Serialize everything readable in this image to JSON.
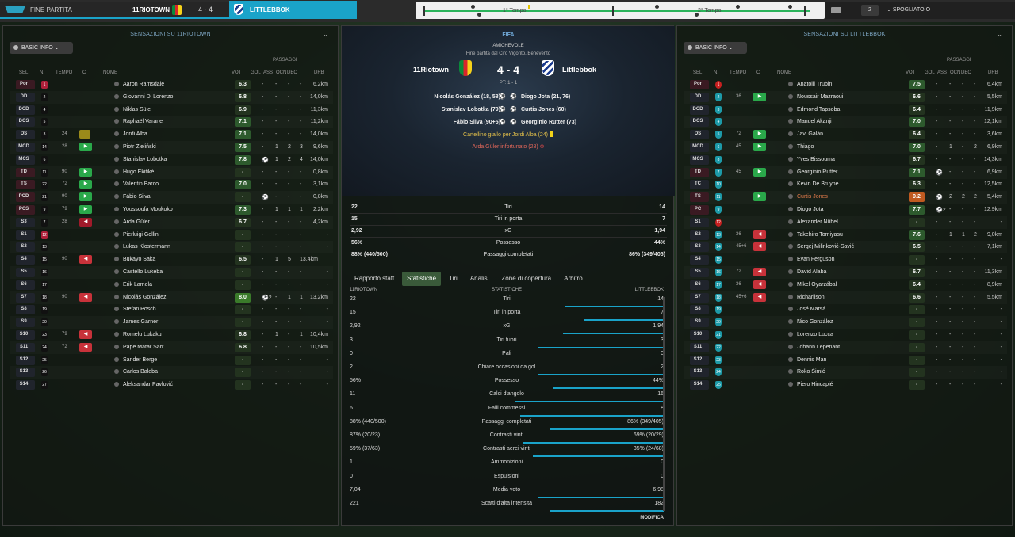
{
  "topbar": {
    "status": "FINE PARTITA",
    "home": "11RIOTOWN",
    "score": "4 - 4",
    "away": "LITTLEBBOK",
    "first_half": "1° Tempo",
    "second_half": "2° Tempo",
    "subs": "2",
    "dropdown": "SPOGLIATOIO"
  },
  "left": {
    "title": "SENSAZIONI SU 11RIOTOWN",
    "basic": "BASIC INFO",
    "passaggi": "PASSAGGI",
    "headers": {
      "sel": "SEL",
      "n": "N.",
      "tempo": "TEMPO",
      "c": "C",
      "nome": "NOME",
      "vot": "VOT",
      "gol": "GOL",
      "ass": "ASS",
      "ocn": "OCN",
      "dec": "DEC",
      "drb": "DRB"
    },
    "rows": [
      {
        "pos": "Por",
        "num": "1",
        "tempo": "",
        "name": "Aaron Ramsdale",
        "vot": "6.3",
        "gol": "-",
        "ass": "-",
        "ocn": "-",
        "dec": "-",
        "drb": "6,2km",
        "pc": "#3a1a22",
        "vc": "#23331f",
        "gk": true
      },
      {
        "pos": "DD",
        "num": "2",
        "tempo": "",
        "name": "Giovanni Di Lorenzo",
        "vot": "6.8",
        "gol": "-",
        "ass": "-",
        "ocn": "-",
        "dec": "-",
        "drb": "14,0km",
        "pc": "#20242c",
        "vc": "#23331f"
      },
      {
        "pos": "DCD",
        "num": "4",
        "tempo": "",
        "name": "Niklas Süle",
        "vot": "6.9",
        "gol": "-",
        "ass": "-",
        "ocn": "-",
        "dec": "-",
        "drb": "11,3km",
        "pc": "#20242c",
        "vc": "#23331f"
      },
      {
        "pos": "DCS",
        "num": "5",
        "tempo": "",
        "name": "Raphaël Varane",
        "vot": "7.1",
        "gol": "-",
        "ass": "-",
        "ocn": "-",
        "dec": "-",
        "drb": "11,2km",
        "pc": "#20242c",
        "vc": "#2d5a2d"
      },
      {
        "pos": "DS",
        "num": "3",
        "tempo": "24",
        "name": "Jordi Alba",
        "vot": "7.1",
        "gol": "-",
        "ass": "-",
        "ocn": "-",
        "dec": "-",
        "drb": "14,0km",
        "pc": "#20242c",
        "vc": "#2d5a2d",
        "yc": true
      },
      {
        "pos": "MCD",
        "num": "14",
        "tempo": "28",
        "name": "Piotr Zieliński",
        "vot": "7.5",
        "gol": "-",
        "ass": "1",
        "ocn": "2",
        "dec": "3",
        "drb": "9,6km",
        "pc": "#20242c",
        "vc": "#2d5a2d",
        "chip": "#2aa84a"
      },
      {
        "pos": "MCS",
        "num": "6",
        "tempo": "",
        "name": "Stanislav Lobotka",
        "vot": "7.8",
        "gol": "⚽",
        "ass": "1",
        "ocn": "2",
        "dec": "4",
        "drb": "14,0km",
        "pc": "#20242c",
        "vc": "#2d5a2d"
      },
      {
        "pos": "TD",
        "num": "11",
        "tempo": "90",
        "name": "Hugo Ekitiké",
        "vot": "-",
        "gol": "-",
        "ass": "-",
        "ocn": "-",
        "dec": "-",
        "drb": "0,8km",
        "pc": "#3a1a22",
        "vc": "#23331f",
        "chip": "#2aa84a"
      },
      {
        "pos": "TS",
        "num": "22",
        "tempo": "72",
        "name": "Valentin Barco",
        "vot": "7.0",
        "gol": "-",
        "ass": "-",
        "ocn": "-",
        "dec": "-",
        "drb": "3,1km",
        "pc": "#3a1a22",
        "vc": "#2d5a2d",
        "chip": "#2aa84a"
      },
      {
        "pos": "PCD",
        "num": "21",
        "tempo": "90",
        "name": "Fábio Silva",
        "vot": "-",
        "gol": "⚽",
        "ass": "-",
        "ocn": "-",
        "dec": "-",
        "drb": "0,8km",
        "pc": "#3a1a22",
        "vc": "#23331f",
        "chip": "#2aa84a"
      },
      {
        "pos": "PCS",
        "num": "9",
        "tempo": "79",
        "name": "Youssoufa Moukoko",
        "vot": "7.3",
        "gol": "-",
        "ass": "1",
        "ocn": "1",
        "dec": "1",
        "drb": "2,2km",
        "pc": "#3a1a22",
        "vc": "#2d5a2d",
        "chip": "#2aa84a"
      },
      {
        "pos": "S3",
        "num": "7",
        "tempo": "28",
        "name": "Arda Güler",
        "vot": "6.7",
        "gol": "-",
        "ass": "-",
        "ocn": "-",
        "dec": "-",
        "drb": "4,2km",
        "pc": "#20242c",
        "vc": "#23331f",
        "chip": "#a01a2a"
      },
      {
        "pos": "S1",
        "num": "12",
        "tempo": "",
        "name": "Pierluigi Gollini",
        "vot": "-",
        "gol": "-",
        "ass": "-",
        "ocn": "-",
        "dec": "-",
        "drb": "-",
        "pc": "#20242c",
        "vc": "#23331f",
        "gk": true
      },
      {
        "pos": "S2",
        "num": "13",
        "tempo": "",
        "name": "Lukas Klostermann",
        "vot": "-",
        "gol": "-",
        "ass": "-",
        "ocn": "-",
        "dec": "-",
        "drb": "-",
        "pc": "#20242c",
        "vc": "#23331f"
      },
      {
        "pos": "S4",
        "num": "15",
        "tempo": "90",
        "name": "Bukayo Saka",
        "vot": "6.5",
        "gol": "-",
        "ass": "1",
        "ocn": "5",
        "dec": "13,4km",
        "drb": "",
        "pc": "#20242c",
        "vc": "#23331f",
        "chip": "#c8323a"
      },
      {
        "pos": "S5",
        "num": "16",
        "tempo": "",
        "name": "Castello Lukeba",
        "vot": "-",
        "gol": "-",
        "ass": "-",
        "ocn": "-",
        "dec": "-",
        "drb": "-",
        "pc": "#20242c",
        "vc": "#23331f"
      },
      {
        "pos": "S6",
        "num": "17",
        "tempo": "",
        "name": "Erik Lamela",
        "vot": "-",
        "gol": "-",
        "ass": "-",
        "ocn": "-",
        "dec": "-",
        "drb": "-",
        "pc": "#20242c",
        "vc": "#23331f"
      },
      {
        "pos": "S7",
        "num": "18",
        "tempo": "90",
        "name": "Nicolás González",
        "vot": "8.0",
        "gol": "⚽2",
        "ass": "-",
        "ocn": "1",
        "dec": "1",
        "drb": "13,2km",
        "pc": "#20242c",
        "vc": "#3a7a2a",
        "chip": "#c8323a"
      },
      {
        "pos": "S8",
        "num": "19",
        "tempo": "",
        "name": "Stefan Posch",
        "vot": "-",
        "gol": "-",
        "ass": "-",
        "ocn": "-",
        "dec": "-",
        "drb": "-",
        "pc": "#20242c",
        "vc": "#23331f"
      },
      {
        "pos": "S9",
        "num": "20",
        "tempo": "",
        "name": "James Garner",
        "vot": "-",
        "gol": "-",
        "ass": "-",
        "ocn": "-",
        "dec": "-",
        "drb": "-",
        "pc": "#20242c",
        "vc": "#23331f"
      },
      {
        "pos": "S10",
        "num": "23",
        "tempo": "79",
        "name": "Romelu Lukaku",
        "vot": "6.8",
        "gol": "-",
        "ass": "1",
        "ocn": "-",
        "dec": "1",
        "drb": "10,4km",
        "pc": "#20242c",
        "vc": "#23331f",
        "chip": "#c8323a"
      },
      {
        "pos": "S11",
        "num": "24",
        "tempo": "72",
        "name": "Pape Matar Sarr",
        "vot": "6.8",
        "gol": "-",
        "ass": "-",
        "ocn": "-",
        "dec": "-",
        "drb": "10,5km",
        "pc": "#20242c",
        "vc": "#23331f",
        "chip": "#c8323a"
      },
      {
        "pos": "S12",
        "num": "25",
        "tempo": "",
        "name": "Sander Berge",
        "vot": "-",
        "gol": "-",
        "ass": "-",
        "ocn": "-",
        "dec": "-",
        "drb": "-",
        "pc": "#20242c",
        "vc": "#23331f"
      },
      {
        "pos": "S13",
        "num": "26",
        "tempo": "",
        "name": "Carlos Baleba",
        "vot": "-",
        "gol": "-",
        "ass": "-",
        "ocn": "-",
        "dec": "-",
        "drb": "-",
        "pc": "#20242c",
        "vc": "#23331f"
      },
      {
        "pos": "S14",
        "num": "27",
        "tempo": "",
        "name": "Aleksandar Pavlović",
        "vot": "-",
        "gol": "-",
        "ass": "-",
        "ocn": "-",
        "dec": "-",
        "drb": "-",
        "pc": "#20242c",
        "vc": "#23331f"
      }
    ]
  },
  "right": {
    "title": "SENSAZIONI SU LITTLEBBOK",
    "basic": "BASIC INFO",
    "passaggi": "PASSAGGI",
    "rows": [
      {
        "pos": "Por",
        "num": "1",
        "tempo": "",
        "name": "Anatolii Trubin",
        "vot": "7.5",
        "gol": "-",
        "ass": "-",
        "ocn": "-",
        "dec": "-",
        "drb": "6,4km",
        "pc": "#3a1a22",
        "vc": "#2d5a2d",
        "gk": true
      },
      {
        "pos": "DD",
        "num": "2",
        "tempo": "36",
        "name": "Noussair Mazraoui",
        "vot": "6.6",
        "gol": "-",
        "ass": "-",
        "ocn": "-",
        "dec": "-",
        "drb": "5,5km",
        "pc": "#20242c",
        "vc": "#23331f",
        "chip": "#2aa84a"
      },
      {
        "pos": "DCD",
        "num": "3",
        "tempo": "",
        "name": "Edmond Tapsoba",
        "vot": "6.4",
        "gol": "-",
        "ass": "-",
        "ocn": "-",
        "dec": "-",
        "drb": "11,9km",
        "pc": "#20242c",
        "vc": "#23331f"
      },
      {
        "pos": "DCS",
        "num": "4",
        "tempo": "",
        "name": "Manuel Akanji",
        "vot": "7.0",
        "gol": "-",
        "ass": "-",
        "ocn": "-",
        "dec": "-",
        "drb": "12,1km",
        "pc": "#20242c",
        "vc": "#2d5a2d"
      },
      {
        "pos": "DS",
        "num": "5",
        "tempo": "72",
        "name": "Javi Galán",
        "vot": "6.4",
        "gol": "-",
        "ass": "-",
        "ocn": "-",
        "dec": "-",
        "drb": "3,6km",
        "pc": "#20242c",
        "vc": "#23331f",
        "chip": "#2aa84a"
      },
      {
        "pos": "MCD",
        "num": "6",
        "tempo": "45",
        "name": "Thiago",
        "vot": "7.0",
        "gol": "-",
        "ass": "1",
        "ocn": "-",
        "dec": "2",
        "drb": "6,9km",
        "pc": "#20242c",
        "vc": "#2d5a2d",
        "chip": "#2aa84a"
      },
      {
        "pos": "MCS",
        "num": "8",
        "tempo": "",
        "name": "Yves Bissouma",
        "vot": "6.7",
        "gol": "-",
        "ass": "-",
        "ocn": "-",
        "dec": "-",
        "drb": "14,3km",
        "pc": "#20242c",
        "vc": "#23331f"
      },
      {
        "pos": "TD",
        "num": "7",
        "tempo": "45",
        "name": "Georginio Rutter",
        "vot": "7.1",
        "gol": "⚽",
        "ass": "-",
        "ocn": "-",
        "dec": "-",
        "drb": "6,9km",
        "pc": "#3a1a22",
        "vc": "#2d5a2d",
        "chip": "#2aa84a"
      },
      {
        "pos": "TC",
        "num": "10",
        "tempo": "",
        "name": "Kevin De Bruyne",
        "vot": "6.3",
        "gol": "-",
        "ass": "-",
        "ocn": "-",
        "dec": "-",
        "drb": "12,5km",
        "pc": "#20242c",
        "vc": "#23331f"
      },
      {
        "pos": "TS",
        "num": "11",
        "tempo": "",
        "name": "Curtis Jones",
        "vot": "9.2",
        "gol": "⚽",
        "ass": "2",
        "ocn": "2",
        "dec": "2",
        "drb": "5,4km",
        "pc": "#3a1a22",
        "vc": "#c05a20",
        "chip": "#2aa84a",
        "hi": true
      },
      {
        "pos": "PC",
        "num": "9",
        "tempo": "",
        "name": "Diogo Jota",
        "vot": "7.7",
        "gol": "⚽2",
        "ass": "-",
        "ocn": "-",
        "dec": "-",
        "drb": "12,9km",
        "pc": "#3a1a22",
        "vc": "#2d5a2d"
      },
      {
        "pos": "S1",
        "num": "12",
        "tempo": "",
        "name": "Alexander Nübel",
        "vot": "-",
        "gol": "-",
        "ass": "-",
        "ocn": "-",
        "dec": "-",
        "drb": "-",
        "pc": "#20242c",
        "vc": "#23331f",
        "gk": true
      },
      {
        "pos": "S2",
        "num": "13",
        "tempo": "36",
        "name": "Takehiro Tomiyasu",
        "vot": "7.6",
        "gol": "-",
        "ass": "1",
        "ocn": "1",
        "dec": "2",
        "drb": "9,0km",
        "pc": "#20242c",
        "vc": "#2d5a2d",
        "chip": "#c8323a"
      },
      {
        "pos": "S3",
        "num": "14",
        "tempo": "45+6",
        "name": "Sergej Milinković-Savić",
        "vot": "6.5",
        "gol": "-",
        "ass": "-",
        "ocn": "-",
        "dec": "-",
        "drb": "7,1km",
        "pc": "#20242c",
        "vc": "#23331f",
        "chip": "#c8323a"
      },
      {
        "pos": "S4",
        "num": "15",
        "tempo": "",
        "name": "Evan Ferguson",
        "vot": "-",
        "gol": "-",
        "ass": "-",
        "ocn": "-",
        "dec": "-",
        "drb": "-",
        "pc": "#20242c",
        "vc": "#23331f"
      },
      {
        "pos": "S5",
        "num": "16",
        "tempo": "72",
        "name": "David Alaba",
        "vot": "6.7",
        "gol": "-",
        "ass": "-",
        "ocn": "-",
        "dec": "-",
        "drb": "11,3km",
        "pc": "#20242c",
        "vc": "#23331f",
        "chip": "#c8323a"
      },
      {
        "pos": "S6",
        "num": "17",
        "tempo": "36",
        "name": "Mikel Oyarzábal",
        "vot": "6.4",
        "gol": "-",
        "ass": "-",
        "ocn": "-",
        "dec": "-",
        "drb": "8,9km",
        "pc": "#20242c",
        "vc": "#23331f",
        "chip": "#c8323a"
      },
      {
        "pos": "S7",
        "num": "18",
        "tempo": "45+6",
        "name": "Richarlison",
        "vot": "6.6",
        "gol": "-",
        "ass": "-",
        "ocn": "-",
        "dec": "-",
        "drb": "5,5km",
        "pc": "#20242c",
        "vc": "#23331f",
        "chip": "#c8323a"
      },
      {
        "pos": "S8",
        "num": "19",
        "tempo": "",
        "name": "José Marsá",
        "vot": "-",
        "gol": "-",
        "ass": "-",
        "ocn": "-",
        "dec": "-",
        "drb": "-",
        "pc": "#20242c",
        "vc": "#23331f"
      },
      {
        "pos": "S9",
        "num": "20",
        "tempo": "",
        "name": "Nico González",
        "vot": "-",
        "gol": "-",
        "ass": "-",
        "ocn": "-",
        "dec": "-",
        "drb": "-",
        "pc": "#20242c",
        "vc": "#23331f"
      },
      {
        "pos": "S10",
        "num": "21",
        "tempo": "",
        "name": "Lorenzo Lucca",
        "vot": "-",
        "gol": "-",
        "ass": "-",
        "ocn": "-",
        "dec": "-",
        "drb": "-",
        "pc": "#20242c",
        "vc": "#23331f"
      },
      {
        "pos": "S11",
        "num": "22",
        "tempo": "",
        "name": "Johann Lepenant",
        "vot": "-",
        "gol": "-",
        "ass": "-",
        "ocn": "-",
        "dec": "-",
        "drb": "-",
        "pc": "#20242c",
        "vc": "#23331f"
      },
      {
        "pos": "S12",
        "num": "23",
        "tempo": "",
        "name": "Dennis Man",
        "vot": "-",
        "gol": "-",
        "ass": "-",
        "ocn": "-",
        "dec": "-",
        "drb": "-",
        "pc": "#20242c",
        "vc": "#23331f"
      },
      {
        "pos": "S13",
        "num": "24",
        "tempo": "",
        "name": "Roko Šimić",
        "vot": "-",
        "gol": "-",
        "ass": "-",
        "ocn": "-",
        "dec": "-",
        "drb": "-",
        "pc": "#20242c",
        "vc": "#23331f"
      },
      {
        "pos": "S14",
        "num": "25",
        "tempo": "",
        "name": "Piero Hincapié",
        "vot": "-",
        "gol": "-",
        "ass": "-",
        "ocn": "-",
        "dec": "-",
        "drb": "-",
        "pc": "#20242c",
        "vc": "#23331f"
      }
    ]
  },
  "center": {
    "fifa": "FIFA",
    "comp": "AMICHEVOLE",
    "venue": "Fine partita dal Ciro Vigorito, Benevento",
    "home": "11Riotown",
    "away": "Littlebbok",
    "score": "4 - 4",
    "ht": "PT: 1 - 1",
    "events": [
      {
        "l": "Nicolás González (18, 58)",
        "r": "Diogo Jota (21, 76)"
      },
      {
        "l": "Stanislav Lobotka (79)",
        "r": "Curtis Jones (60)"
      },
      {
        "l": "Fábio Silva (90+5)",
        "r": "Georginio Rutter (73)"
      }
    ],
    "yellow": "Cartellino giallo per Jordi Alba (24)",
    "injury": "Arda Güler infortunato (28)",
    "summary": [
      {
        "l": "22",
        "m": "Tiri",
        "r": "14"
      },
      {
        "l": "15",
        "m": "Tiri in porta",
        "r": "7"
      },
      {
        "l": "2,92",
        "m": "xG",
        "r": "1,94"
      },
      {
        "l": "56%",
        "m": "Possesso",
        "r": "44%"
      },
      {
        "l": "88% (440/500)",
        "m": "Passaggi completati",
        "r": "86% (349/405)"
      }
    ],
    "tabs": [
      "Rapporto staff",
      "Statistiche",
      "Tiri",
      "Analisi",
      "Zone di copertura",
      "Arbitro"
    ],
    "stats_head": {
      "l": "11RIOTOWN",
      "m": "STATISTICHE",
      "r": "LITTLEBBOK"
    },
    "stats": [
      {
        "l": "22",
        "m": "Tiri",
        "r": "14",
        "p": 0.39
      },
      {
        "l": "15",
        "m": "Tiri in porta",
        "r": "7",
        "p": 0.32
      },
      {
        "l": "2,92",
        "m": "xG",
        "r": "1,94",
        "p": 0.4
      },
      {
        "l": "3",
        "m": "Tiri fuori",
        "r": "3",
        "p": 0.5
      },
      {
        "l": "0",
        "m": "Pali",
        "r": "0",
        "p": 0
      },
      {
        "l": "2",
        "m": "Chiare occasioni da gol",
        "r": "2",
        "p": 0.5
      },
      {
        "l": "56%",
        "m": "Possesso",
        "r": "44%",
        "p": 0.44
      },
      {
        "l": "11",
        "m": "Calci d'angolo",
        "r": "16",
        "p": 0.59
      },
      {
        "l": "6",
        "m": "Falli commessi",
        "r": "8",
        "p": 0.57
      },
      {
        "l": "88% (440/500)",
        "m": "Passaggi completati",
        "r": "86% (349/405)",
        "p": 0.45
      },
      {
        "l": "87% (20/23)",
        "m": "Contrasti vinti",
        "r": "69% (20/29)",
        "p": 0.56
      },
      {
        "l": "59% (37/63)",
        "m": "Contrasti aerei vinti",
        "r": "35% (24/68)",
        "p": 0.52
      },
      {
        "l": "1",
        "m": "Ammonizioni",
        "r": "0",
        "p": 0
      },
      {
        "l": "0",
        "m": "Espulsioni",
        "r": "0",
        "p": 0
      },
      {
        "l": "7,04",
        "m": "Media voto",
        "r": "6,98",
        "p": 0.5
      },
      {
        "l": "221",
        "m": "Scatti d'alta intensità",
        "r": "182",
        "p": 0.45
      }
    ],
    "modifica": "MODIFICA"
  }
}
